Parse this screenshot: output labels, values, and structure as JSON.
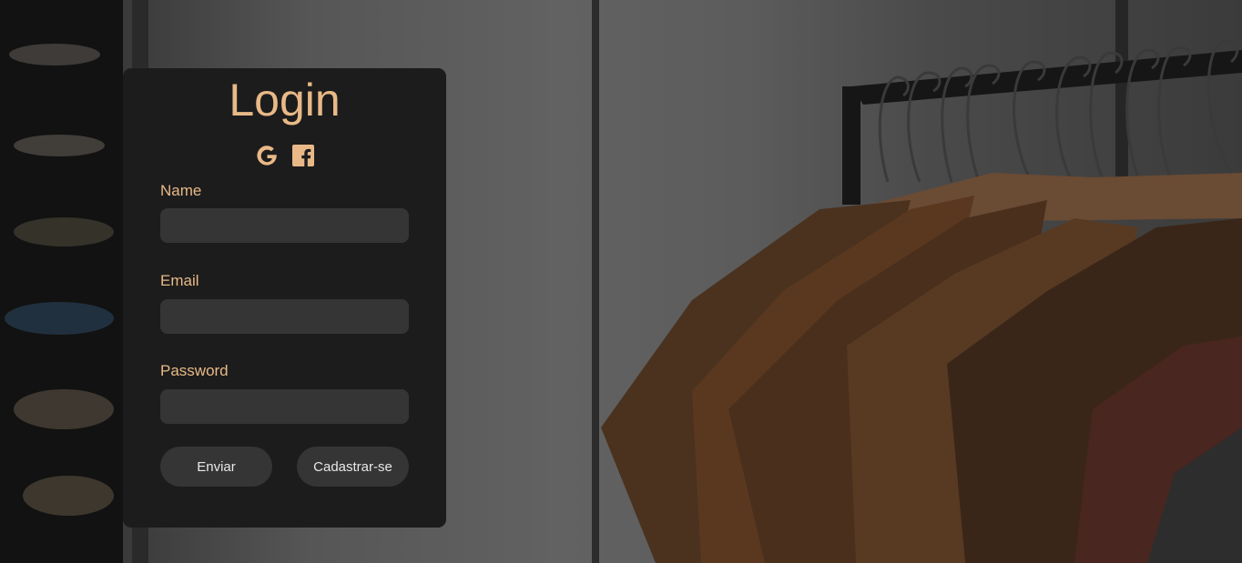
{
  "login": {
    "title": "Login",
    "social": [
      "google-icon",
      "facebook-icon"
    ],
    "fields": {
      "name": {
        "label": "Name",
        "value": "",
        "placeholder": ""
      },
      "email": {
        "label": "Email",
        "value": "",
        "placeholder": ""
      },
      "password": {
        "label": "Password",
        "value": "",
        "placeholder": ""
      }
    },
    "buttons": {
      "submit": "Enviar",
      "signup": "Cadastrar-se"
    }
  },
  "colors": {
    "accent": "#e8b987",
    "card_bg": "#1c1c1c",
    "input_bg": "#353535",
    "button_text": "#e8e8e8"
  }
}
